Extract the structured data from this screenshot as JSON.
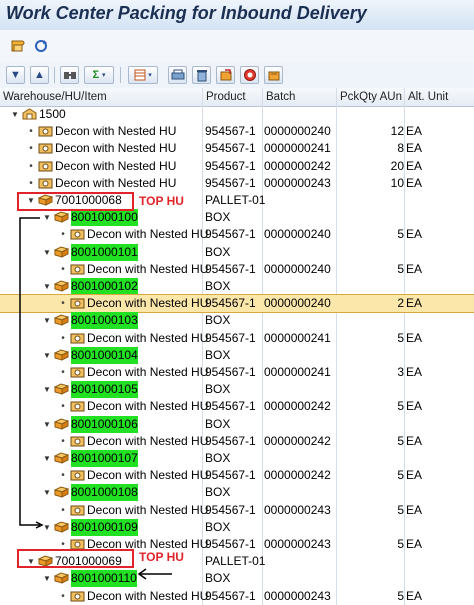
{
  "window": {
    "title": "Work Center Packing for Inbound Delivery"
  },
  "toolbar1": {
    "icons": [
      "scroll-icon",
      "refresh-icon"
    ]
  },
  "toolbar2": {
    "icons": [
      "collapse-all-icon",
      "expand-all-icon",
      "find-icon",
      "sum-icon",
      "layout-icon",
      "print-icon",
      "delete-icon",
      "pack-icon",
      "unpack-icon",
      "hu-icon"
    ]
  },
  "columns": {
    "item": "Warehouse/HU/Item",
    "product": "Product",
    "batch": "Batch",
    "qty": "PckQty AUn",
    "unit": "Alt. Unit"
  },
  "annotations": {
    "top_hu_1": "TOP HU",
    "top_hu_2": "TOP HU"
  },
  "rows": [
    {
      "label": "1500",
      "kind": "warehouse",
      "level": 0,
      "expand": "open",
      "product": "",
      "batch": "",
      "qty": "",
      "unit": ""
    },
    {
      "label": "Decon with Nested HU",
      "kind": "item",
      "level": 1,
      "product": "954567-1",
      "batch": "0000000240",
      "qty": "12",
      "unit": "EA"
    },
    {
      "label": "Decon with Nested HU",
      "kind": "item",
      "level": 1,
      "product": "954567-1",
      "batch": "0000000241",
      "qty": "8",
      "unit": "EA"
    },
    {
      "label": "Decon with Nested HU",
      "kind": "item",
      "level": 1,
      "product": "954567-1",
      "batch": "0000000242",
      "qty": "20",
      "unit": "EA"
    },
    {
      "label": "Decon with Nested HU",
      "kind": "item",
      "level": 1,
      "product": "954567-1",
      "batch": "0000000243",
      "qty": "10",
      "unit": "EA"
    },
    {
      "label": "7001000068",
      "kind": "hu",
      "level": 1,
      "expand": "open",
      "product": "PALLET-01",
      "batch": "",
      "qty": "",
      "unit": ""
    },
    {
      "label": "8001000100",
      "kind": "hu",
      "level": 2,
      "expand": "open",
      "hl": true,
      "product": "BOX",
      "batch": "",
      "qty": "",
      "unit": ""
    },
    {
      "label": "Decon with Nested HU",
      "kind": "item",
      "level": 3,
      "product": "954567-1",
      "batch": "0000000240",
      "qty": "5",
      "unit": "EA"
    },
    {
      "label": "8001000101",
      "kind": "hu",
      "level": 2,
      "expand": "open",
      "hl": true,
      "product": "BOX",
      "batch": "",
      "qty": "",
      "unit": ""
    },
    {
      "label": "Decon with Nested HU",
      "kind": "item",
      "level": 3,
      "product": "954567-1",
      "batch": "0000000240",
      "qty": "5",
      "unit": "EA"
    },
    {
      "label": "8001000102",
      "kind": "hu",
      "level": 2,
      "expand": "open",
      "hl": true,
      "product": "BOX",
      "batch": "",
      "qty": "",
      "unit": ""
    },
    {
      "label": "Decon with Nested HU",
      "kind": "item",
      "level": 3,
      "selected": true,
      "product": "954567-1",
      "batch": "0000000240",
      "qty": "2",
      "unit": "EA"
    },
    {
      "label": "8001000103",
      "kind": "hu",
      "level": 2,
      "expand": "open",
      "hl": true,
      "product": "BOX",
      "batch": "",
      "qty": "",
      "unit": ""
    },
    {
      "label": "Decon with Nested HU",
      "kind": "item",
      "level": 3,
      "product": "954567-1",
      "batch": "0000000241",
      "qty": "5",
      "unit": "EA"
    },
    {
      "label": "8001000104",
      "kind": "hu",
      "level": 2,
      "expand": "open",
      "hl": true,
      "product": "BOX",
      "batch": "",
      "qty": "",
      "unit": ""
    },
    {
      "label": "Decon with Nested HU",
      "kind": "item",
      "level": 3,
      "product": "954567-1",
      "batch": "0000000241",
      "qty": "3",
      "unit": "EA"
    },
    {
      "label": "8001000105",
      "kind": "hu",
      "level": 2,
      "expand": "open",
      "hl": true,
      "product": "BOX",
      "batch": "",
      "qty": "",
      "unit": ""
    },
    {
      "label": "Decon with Nested HU",
      "kind": "item",
      "level": 3,
      "product": "954567-1",
      "batch": "0000000242",
      "qty": "5",
      "unit": "EA"
    },
    {
      "label": "8001000106",
      "kind": "hu",
      "level": 2,
      "expand": "open",
      "hl": true,
      "product": "BOX",
      "batch": "",
      "qty": "",
      "unit": ""
    },
    {
      "label": "Decon with Nested HU",
      "kind": "item",
      "level": 3,
      "product": "954567-1",
      "batch": "0000000242",
      "qty": "5",
      "unit": "EA"
    },
    {
      "label": "8001000107",
      "kind": "hu",
      "level": 2,
      "expand": "open",
      "hl": true,
      "product": "BOX",
      "batch": "",
      "qty": "",
      "unit": ""
    },
    {
      "label": "Decon with Nested HU",
      "kind": "item",
      "level": 3,
      "product": "954567-1",
      "batch": "0000000242",
      "qty": "5",
      "unit": "EA"
    },
    {
      "label": "8001000108",
      "kind": "hu",
      "level": 2,
      "expand": "open",
      "hl": true,
      "product": "BOX",
      "batch": "",
      "qty": "",
      "unit": ""
    },
    {
      "label": "Decon with Nested HU",
      "kind": "item",
      "level": 3,
      "product": "954567-1",
      "batch": "0000000243",
      "qty": "5",
      "unit": "EA"
    },
    {
      "label": "8001000109",
      "kind": "hu",
      "level": 2,
      "expand": "open",
      "hl": true,
      "product": "BOX",
      "batch": "",
      "qty": "",
      "unit": ""
    },
    {
      "label": "Decon with Nested HU",
      "kind": "item",
      "level": 3,
      "product": "954567-1",
      "batch": "0000000243",
      "qty": "5",
      "unit": "EA"
    },
    {
      "label": "7001000069",
      "kind": "hu",
      "level": 1,
      "expand": "open",
      "product": "PALLET-01",
      "batch": "",
      "qty": "",
      "unit": ""
    },
    {
      "label": "8001000110",
      "kind": "hu",
      "level": 2,
      "expand": "open",
      "hl": true,
      "product": "BOX",
      "batch": "",
      "qty": "",
      "unit": ""
    },
    {
      "label": "Decon with Nested HU",
      "kind": "item",
      "level": 3,
      "product": "954567-1",
      "batch": "0000000243",
      "qty": "5",
      "unit": "EA"
    }
  ],
  "colors": {
    "highlight": "#22e022",
    "annotation": "#e0242a",
    "selected_row": "#fbe7a9"
  }
}
